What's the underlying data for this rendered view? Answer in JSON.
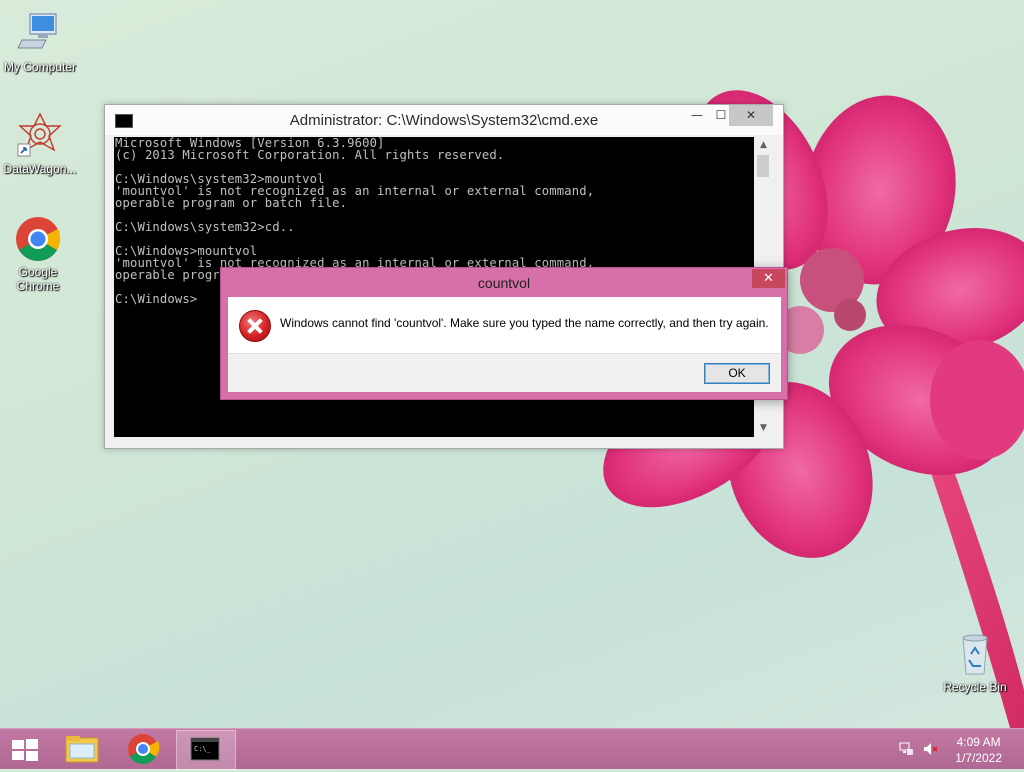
{
  "desktop": {
    "icons": [
      {
        "label": "My Computer"
      },
      {
        "label": "DataWagon..."
      },
      {
        "label": "Google Chrome"
      },
      {
        "label": "Recycle Bin"
      }
    ]
  },
  "cmd_window": {
    "title": "Administrator: C:\\Windows\\System32\\cmd.exe",
    "console_lines": [
      "Microsoft Windows [Version 6.3.9600]",
      "(c) 2013 Microsoft Corporation. All rights reserved.",
      "",
      "C:\\Windows\\system32>mountvol",
      "'mountvol' is not recognized as an internal or external command,",
      "operable program or batch file.",
      "",
      "C:\\Windows\\system32>cd..",
      "",
      "C:\\Windows>mountvol",
      "'mountvol' is not recognized as an internal or external command,",
      "operable program or batch file.",
      "",
      "C:\\Windows>"
    ],
    "minimize_glyph": "—",
    "maximize_glyph": "☐",
    "close_glyph": "✕"
  },
  "error_dialog": {
    "title": "countvol",
    "message": "Windows cannot find 'countvol'. Make sure you typed the name correctly, and then try again.",
    "ok_label": "OK",
    "close_glyph": "✕"
  },
  "taskbar": {
    "time": "4:09 AM",
    "date": "1/7/2022"
  },
  "colors": {
    "taskbar": "#b86e9a",
    "dialog_frame": "#d770a8",
    "console_bg": "#000000",
    "console_text": "#c0c0c0"
  }
}
